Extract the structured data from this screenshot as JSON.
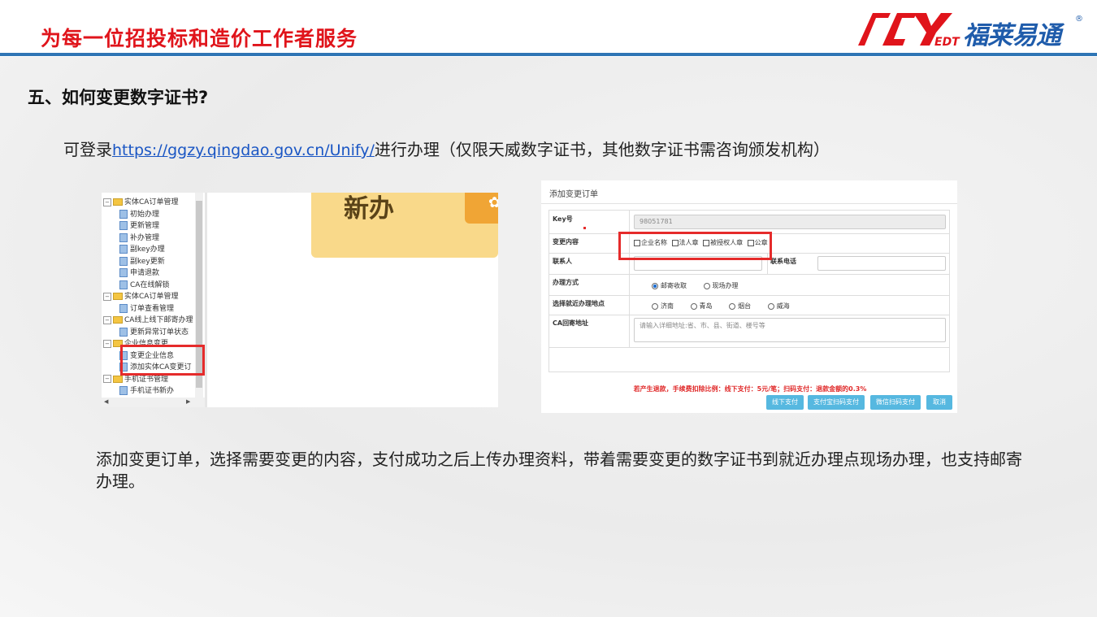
{
  "header": {
    "slogan": "为每一位招投标和造价工作者服务",
    "logo_brand": "福莱易通",
    "logo_mark": "EDT",
    "logo_reg": "®"
  },
  "section": {
    "heading": "五、如何变更数字证书?",
    "intro_prefix": "可登录",
    "intro_link": "https://ggzy.qingdao.gov.cn/Unify/",
    "intro_suffix": "进行办理（仅限天威数字证书，其他数字证书需咨询颁发机构）"
  },
  "left_screenshot": {
    "tree": [
      {
        "type": "folder",
        "label": "实体CA订单管理",
        "expand": "−"
      },
      {
        "type": "page",
        "label": "初始办理"
      },
      {
        "type": "page",
        "label": "更新管理"
      },
      {
        "type": "page",
        "label": "补办管理"
      },
      {
        "type": "page",
        "label": "副key办理"
      },
      {
        "type": "page",
        "label": "副key更新"
      },
      {
        "type": "page",
        "label": "申请退款"
      },
      {
        "type": "page",
        "label": "CA在线解锁"
      },
      {
        "type": "folder",
        "label": "实体CA订单管理",
        "expand": "−"
      },
      {
        "type": "page",
        "label": "订单查看管理"
      },
      {
        "type": "folder",
        "label": "CA线上线下邮寄办理",
        "expand": "−"
      },
      {
        "type": "page",
        "label": "更新异常订单状态"
      },
      {
        "type": "folder",
        "label": "企业信息变更",
        "expand": "−"
      },
      {
        "type": "page",
        "label": "变更企业信息"
      },
      {
        "type": "page",
        "label": "添加实体CA变更订"
      },
      {
        "type": "folder",
        "label": "手机证书管理",
        "expand": "−"
      },
      {
        "type": "page",
        "label": "手机证书新办"
      }
    ],
    "card_title": "新办",
    "card_badge_icon": "gear-icon"
  },
  "right_screenshot": {
    "title": "添加变更订单",
    "key_label": "Key号",
    "key_value": "98051781",
    "change_label": "变更内容",
    "change_options": [
      "企业名称",
      "法人章",
      "被授权人章",
      "公章"
    ],
    "contact_label": "联系人",
    "phone_label": "联系电话",
    "method_label": "办理方式",
    "method_options": [
      "邮寄收取",
      "现场办理"
    ],
    "method_selected": "邮寄收取",
    "location_label": "选择就近办理地点",
    "location_options": [
      "济南",
      "青岛",
      "烟台",
      "威海"
    ],
    "address_label": "CA回寄地址",
    "address_placeholder": "请输入详细地址:省、市、县、街道、楼号等",
    "notice": "若产生退款，手续费扣除比例：线下支付：5元/笔；扫码支付：退款金额的0.3%",
    "buttons": [
      "线下支付",
      "支付宝扫码支付",
      "微信扫码支付",
      "取消"
    ]
  },
  "description": "添加变更订单，选择需要变更的内容，支付成功之后上传办理资料，带着需要变更的数字证书到就近办理点现场办理，也支持邮寄办理。",
  "colors": {
    "slogan": "#e0141b",
    "header_line": "#2f75b5",
    "highlight_box": "#e52b2b",
    "button": "#56b8e0",
    "link": "#1a56c4"
  }
}
